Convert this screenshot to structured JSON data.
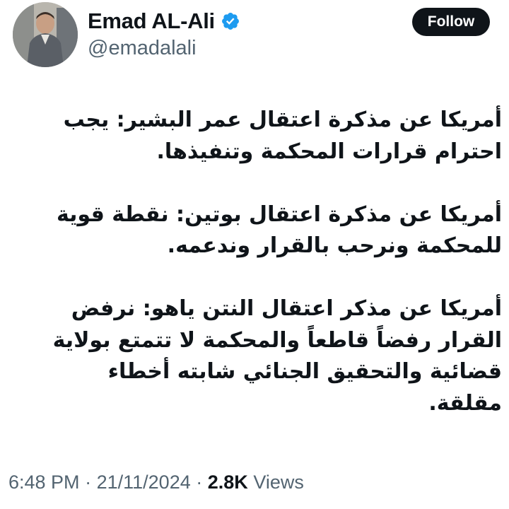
{
  "author": {
    "display_name": "Emad AL-Ali",
    "handle": "@emadalali",
    "verified": true,
    "badge_color": "#1d9bf0"
  },
  "follow_button": {
    "label": "Follow"
  },
  "tweet": {
    "paragraphs": [
      "أمريكا عن مذكرة اعتقال عمر البشير: يجب\nاحترام قرارات المحكمة وتنفيذها.",
      "أمريكا عن مذكرة اعتقال بوتين: نقطة قوية\nللمحكمة ونرحب بالقرار وندعمه.",
      "أمريكا عن مذكر اعتقال النتن ياهو: نرفض\nالقرار رفضاً قاطعاً والمحكمة لا تتمتع بولاية\nقضائية والتحقيق الجنائي شابته أخطاء\nمقلقة."
    ]
  },
  "meta": {
    "time": "6:48 PM",
    "separator": "·",
    "date": "21/11/2024",
    "views_count": "2.8K",
    "views_label": "Views"
  }
}
